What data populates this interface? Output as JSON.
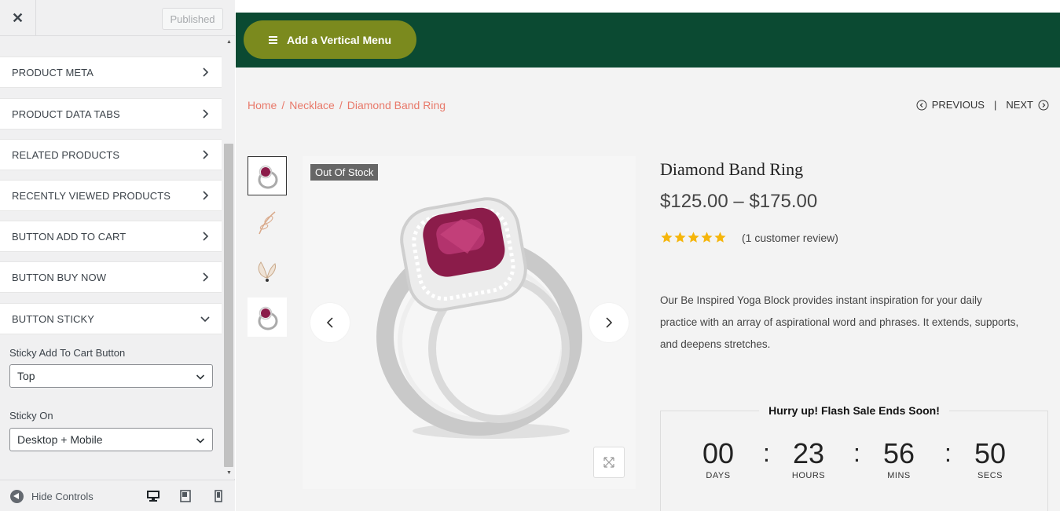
{
  "customizer": {
    "close_label": "✕",
    "published_label": "Published",
    "sections": [
      {
        "label": "PRODUCT META"
      },
      {
        "label": "PRODUCT DATA TABS"
      },
      {
        "label": "RELATED PRODUCTS"
      },
      {
        "label": "RECENTLY VIEWED PRODUCTS"
      },
      {
        "label": "BUTTON ADD TO CART"
      },
      {
        "label": "BUTTON BUY NOW"
      },
      {
        "label": "BUTTON STICKY"
      }
    ],
    "controls": {
      "sticky_button_label": "Sticky Add To Cart Button",
      "sticky_button_value": "Top",
      "sticky_on_label": "Sticky On",
      "sticky_on_value": "Desktop + Mobile"
    },
    "footer": {
      "hide_controls_label": "Hide Controls"
    }
  },
  "preview": {
    "vertical_menu_label": "Add a Vertical Menu",
    "breadcrumb": [
      "Home",
      "Necklace",
      "Diamond Band Ring"
    ],
    "nav": {
      "previous": "PREVIOUS",
      "next": "NEXT"
    },
    "badge": "Out Of Stock",
    "product": {
      "title": "Diamond Band Ring",
      "price": "$125.00 – $175.00",
      "rating": 5,
      "review_link": "(1 customer review)",
      "description": "Our Be Inspired Yoga Block provides instant inspiration for your daily practice with an array of aspirational word and phrases. It extends, supports, and deepens stretches."
    },
    "countdown": {
      "title": "Hurry up! Flash Sale Ends Soon!",
      "units": [
        {
          "value": "00",
          "label": "DAYS"
        },
        {
          "value": "23",
          "label": "HOURS"
        },
        {
          "value": "56",
          "label": "MINS"
        },
        {
          "value": "50",
          "label": "SECS"
        }
      ],
      "separator": ":"
    }
  },
  "colors": {
    "header_green": "#0b4a32",
    "menu_button": "#7b8a1e",
    "breadcrumb": "#e8796a",
    "star": "#f5b50a"
  }
}
